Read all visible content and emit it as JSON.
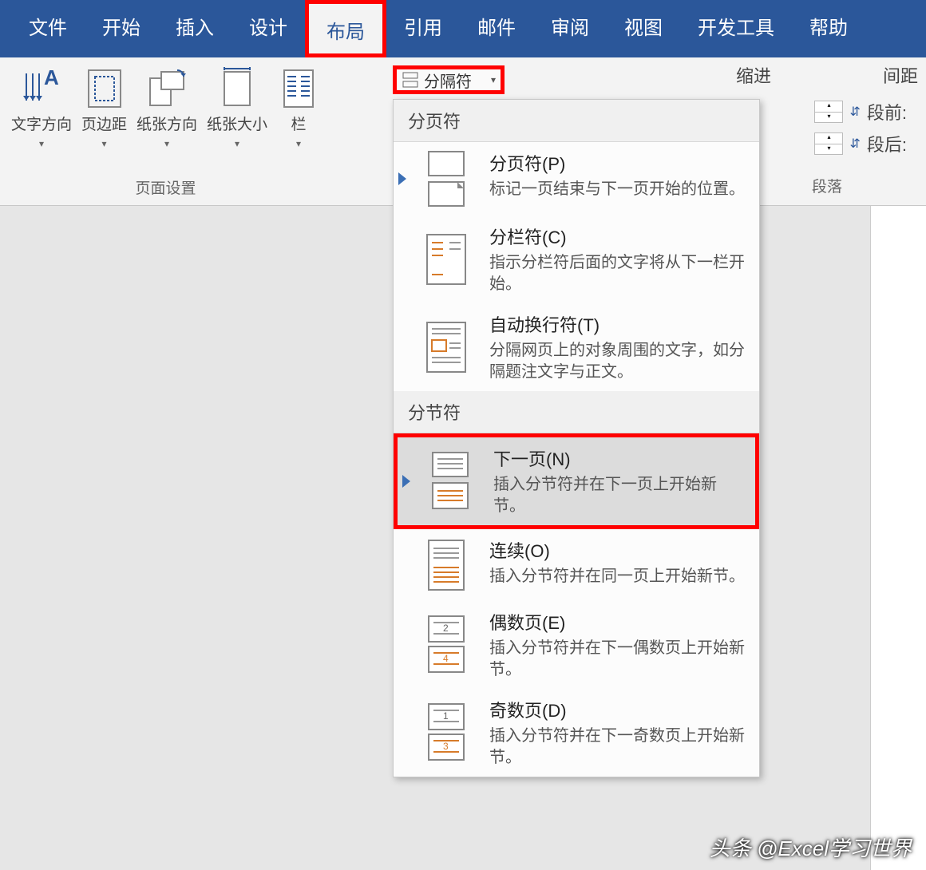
{
  "tabs": {
    "file": "文件",
    "home": "开始",
    "insert": "插入",
    "design": "设计",
    "layout": "布局",
    "references": "引用",
    "mailings": "邮件",
    "review": "审阅",
    "view": "视图",
    "devtools": "开发工具",
    "help": "帮助"
  },
  "page_setup": {
    "text_direction": "文字方向",
    "margins": "页边距",
    "orientation": "纸张方向",
    "size": "纸张大小",
    "columns": "栏",
    "group_name": "页面设置",
    "breaks": "分隔符"
  },
  "indent": {
    "header": "缩进"
  },
  "spacing": {
    "header": "间距",
    "before": "段前:",
    "after": "段后:",
    "group_name": "段落"
  },
  "breaks_menu": {
    "section1": "分页符",
    "page": {
      "title": "分页符(P)",
      "desc": "标记一页结束与下一页开始的位置。"
    },
    "column": {
      "title": "分栏符(C)",
      "desc": "指示分栏符后面的文字将从下一栏开始。"
    },
    "wrap": {
      "title": "自动换行符(T)",
      "desc": "分隔网页上的对象周围的文字，如分隔题注文字与正文。"
    },
    "section2": "分节符",
    "next": {
      "title": "下一页(N)",
      "desc": "插入分节符并在下一页上开始新节。"
    },
    "cont": {
      "title": "连续(O)",
      "desc": "插入分节符并在同一页上开始新节。"
    },
    "even": {
      "title": "偶数页(E)",
      "desc": "插入分节符并在下一偶数页上开始新节。"
    },
    "odd": {
      "title": "奇数页(D)",
      "desc": "插入分节符并在下一奇数页上开始新节。"
    }
  },
  "watermark": "头条 @Excel学习世界"
}
